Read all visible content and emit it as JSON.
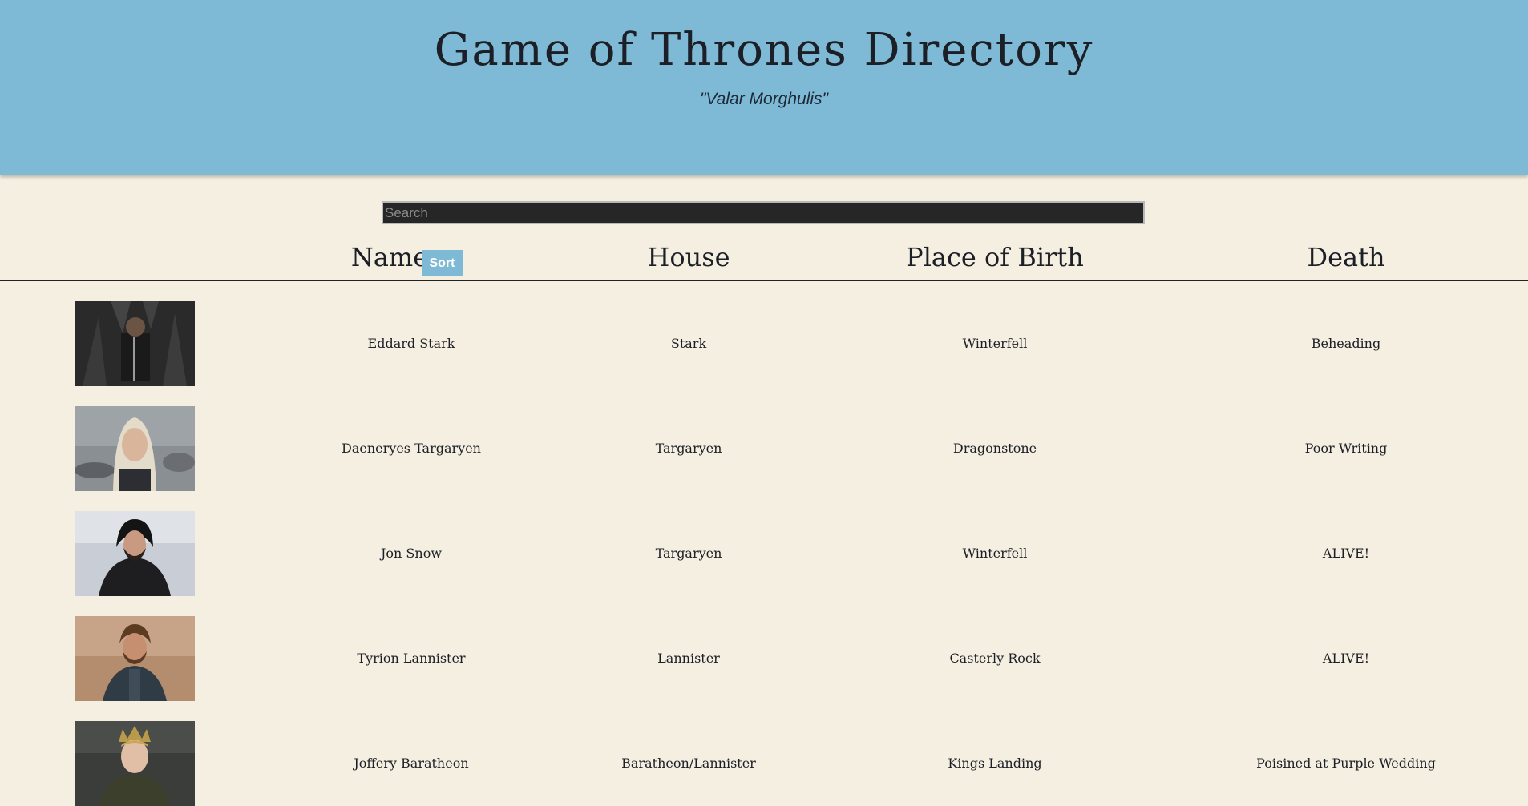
{
  "header": {
    "title": "Game of Thrones Directory",
    "motto": "\"Valar Morghulis\""
  },
  "search": {
    "placeholder": "Search",
    "value": ""
  },
  "table": {
    "columns": {
      "name": "Name",
      "house": "House",
      "birth": "Place of Birth",
      "death": "Death"
    },
    "sort_label": "Sort",
    "rows": [
      {
        "name": "Eddard Stark",
        "house": "Stark",
        "birth": "Winterfell",
        "death": "Beheading"
      },
      {
        "name": "Daeneryes Targaryen",
        "house": "Targaryen",
        "birth": "Dragonstone",
        "death": "Poor Writing"
      },
      {
        "name": "Jon Snow",
        "house": "Targaryen",
        "birth": "Winterfell",
        "death": "ALIVE!"
      },
      {
        "name": "Tyrion Lannister",
        "house": "Lannister",
        "birth": "Casterly Rock",
        "death": "ALIVE!"
      },
      {
        "name": "Joffery Baratheon",
        "house": "Baratheon/Lannister",
        "birth": "Kings Landing",
        "death": "Poisined at Purple Wedding"
      }
    ]
  },
  "colors": {
    "header_bg": "#7ebad5",
    "page_bg": "#f5efe1",
    "search_bg": "#262626",
    "text": "#1c1f26"
  }
}
